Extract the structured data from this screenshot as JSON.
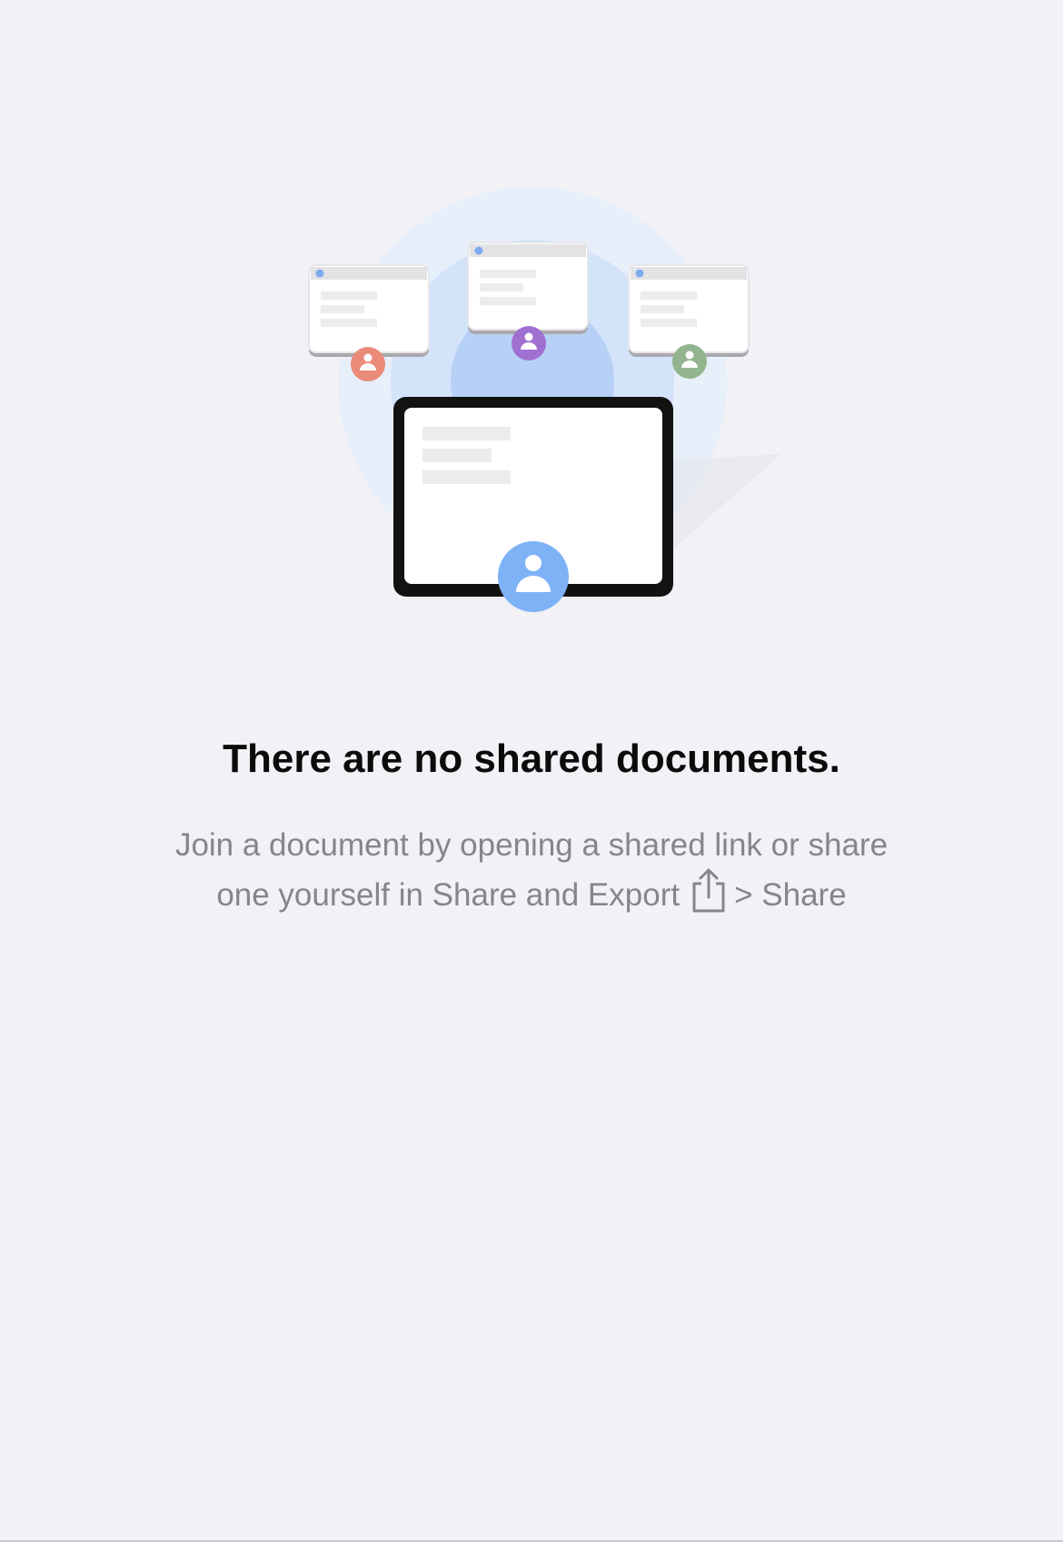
{
  "empty_state": {
    "title": "There are no shared documents.",
    "message_part1": "Join a document by opening a shared link or share one yourself in Share and Export",
    "message_separator": ">",
    "message_part2": "Share",
    "share_icon_name": "share-icon"
  },
  "colors": {
    "background": "#f1f1f6",
    "title": "#0b0b0c",
    "subtitle": "#85858b",
    "avatar_main": "#7eb2f7",
    "avatar_orange": "#ea8a78",
    "avatar_purple": "#a070d0",
    "avatar_green": "#92b48e"
  }
}
